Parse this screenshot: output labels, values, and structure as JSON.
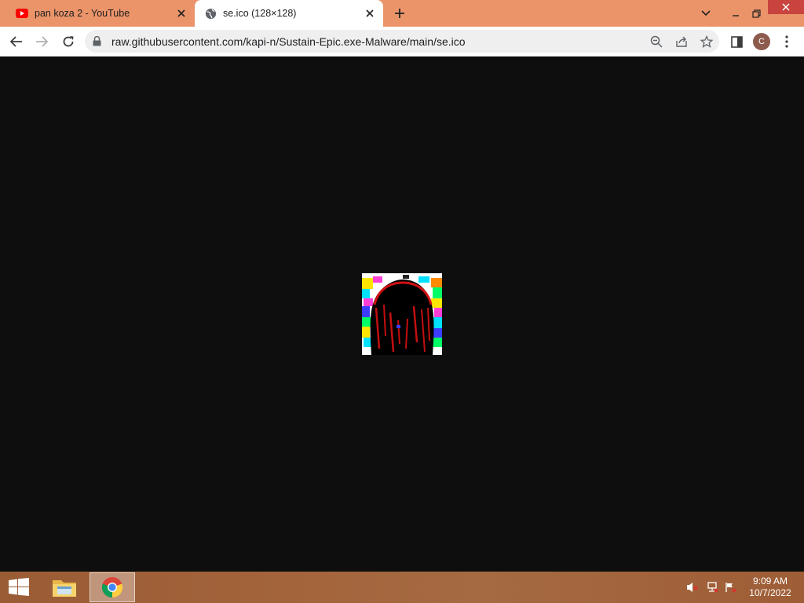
{
  "browser": {
    "tabs": [
      {
        "title": "pan koza 2 - YouTube",
        "favicon": "youtube-icon",
        "active": false
      },
      {
        "title": "se.ico (128×128)",
        "favicon": "globe-icon",
        "active": true
      }
    ],
    "address_bar": {
      "url": "raw.githubusercontent.com/kapi-n/Sustain-Epic.exe-Malware/main/se.ico"
    },
    "profile_initial": "C"
  },
  "content": {
    "image_description": "se.ico",
    "background": "#0e0e0e"
  },
  "taskbar": {
    "items": [
      "start-icon",
      "file-explorer-icon",
      "chrome-icon"
    ],
    "clock": {
      "time": "9:09 AM",
      "date": "10/7/2022"
    }
  },
  "colors": {
    "tabstrip": "#eb946a",
    "close_window": "#c9443f",
    "taskbar": "#a4653c"
  }
}
